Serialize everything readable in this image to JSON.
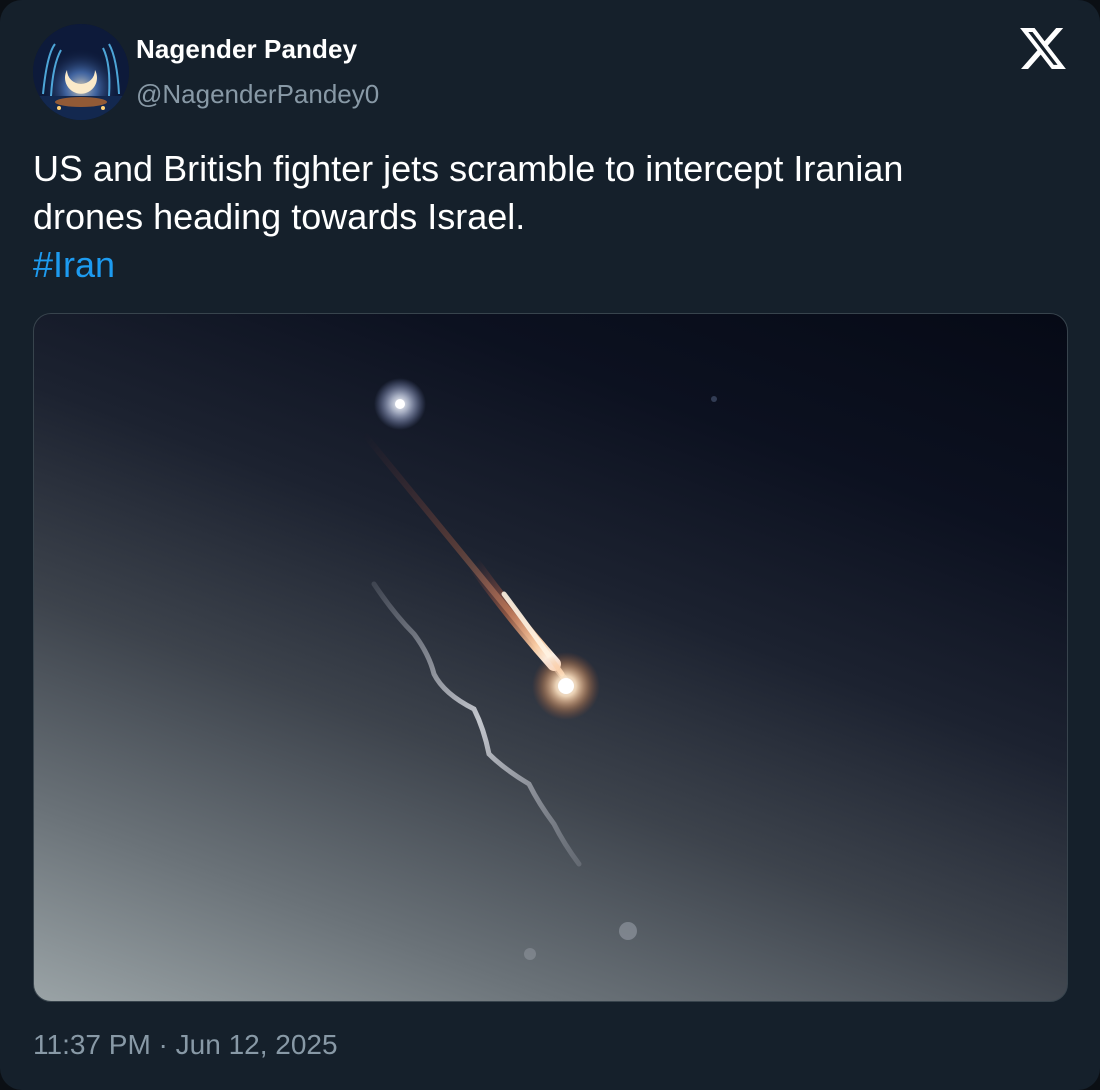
{
  "tweet": {
    "author": {
      "display_name": "Nagender Pandey",
      "handle": "@NagenderPandey0"
    },
    "platform_logo": "x-logo-icon",
    "text_lines": [
      "US and British fighter jets scramble to intercept Iranian",
      "drones heading towards Israel."
    ],
    "hashtag": "#Iran",
    "media": {
      "type": "photo",
      "icon": "night-sky-missile-photo"
    },
    "timestamp": "11:37 PM · Jun 12, 2025"
  },
  "colors": {
    "background": "#15202b",
    "text_primary": "#ffffff",
    "text_secondary": "#8899a6",
    "link": "#1d9bf0",
    "border": "#38444d"
  }
}
